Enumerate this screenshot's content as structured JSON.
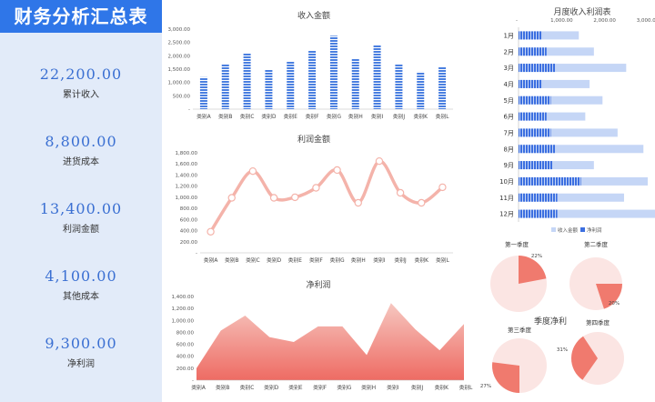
{
  "page_title": "财务分析汇总表",
  "kpis": [
    {
      "value": "22,200.00",
      "label": "累计收入"
    },
    {
      "value": "8,800.00",
      "label": "进货成本"
    },
    {
      "value": "13,400.00",
      "label": "利润金额"
    },
    {
      "value": "4,100.00",
      "label": "其他成本"
    },
    {
      "value": "9,300.00",
      "label": "净利润"
    }
  ],
  "colors": {
    "bar": "#4a7fe0",
    "line": "#f4b3aa",
    "area_top": "#f6c7c0",
    "area_bottom": "#ee6b63",
    "revenue_bar": "#c5d6f6",
    "profit_bar": "#3c6fe0",
    "pie_bg": "#fbe5e3",
    "pie_slice": "#f07a6e"
  },
  "chart_data": [
    {
      "type": "bar",
      "title": "收入金额",
      "categories": [
        "类别A",
        "类别B",
        "类别C",
        "类别D",
        "类别E",
        "类别F",
        "类别G",
        "类别H",
        "类别I",
        "类别J",
        "类别K",
        "类别L"
      ],
      "y_ticks": [
        "3,000.00",
        "2,500.00",
        "2,000.00",
        "1,500.00",
        "1,000.00",
        "500.00",
        "-"
      ],
      "ylim": [
        0,
        3000
      ],
      "values": [
        1200,
        1700,
        2100,
        1500,
        1800,
        2200,
        2750,
        1900,
        2400,
        1700,
        1400,
        1600
      ]
    },
    {
      "type": "line",
      "title": "利润金额",
      "categories": [
        "类别A",
        "类别B",
        "类别C",
        "类别D",
        "类别E",
        "类别F",
        "类别G",
        "类别H",
        "类别I",
        "类别J",
        "类别K",
        "类别L"
      ],
      "y_ticks": [
        "1,800.00",
        "1,600.00",
        "1,400.00",
        "1,200.00",
        "1,000.00",
        "800.00",
        "600.00",
        "400.00",
        "200.00",
        "-"
      ],
      "ylim": [
        0,
        1800
      ],
      "values": [
        380,
        990,
        1470,
        990,
        1000,
        1170,
        1490,
        900,
        1650,
        1080,
        900,
        1180
      ]
    },
    {
      "type": "area",
      "title": "净利润",
      "categories": [
        "类别A",
        "类别B",
        "类别C",
        "类别D",
        "类别E",
        "类别F",
        "类别G",
        "类别H",
        "类别I",
        "类别J",
        "类别K",
        "类别L"
      ],
      "y_ticks": [
        "1,400.00",
        "1,200.00",
        "1,000.00",
        "800.00",
        "600.00",
        "400.00",
        "200.00",
        "-"
      ],
      "ylim": [
        0,
        1400
      ],
      "values": [
        200,
        830,
        1080,
        720,
        640,
        900,
        900,
        420,
        1290,
        850,
        500,
        940
      ]
    },
    {
      "type": "bar",
      "orientation": "horizontal",
      "title": "月度收入利润表",
      "categories": [
        "1月",
        "2月",
        "3月",
        "4月",
        "5月",
        "6月",
        "7月",
        "8月",
        "9月",
        "10月",
        "11月",
        "12月"
      ],
      "x_ticks": [
        "-",
        "1,000.00",
        "2,000.00",
        "3,000.00"
      ],
      "xlim": [
        0,
        3000
      ],
      "legend": [
        "收入金额",
        "净利润"
      ],
      "legend_position": "bottom",
      "series": [
        {
          "name": "收入金额",
          "values": [
            1400,
            1750,
            2500,
            1650,
            1950,
            1550,
            2300,
            2900,
            1750,
            3000,
            2450,
            3200
          ]
        },
        {
          "name": "净利润",
          "values": [
            550,
            650,
            850,
            550,
            750,
            650,
            750,
            850,
            800,
            1450,
            900,
            900
          ]
        }
      ]
    },
    {
      "type": "pie",
      "title": "季度净利",
      "subcharts": [
        {
          "title": "第一季度",
          "value_label": "22%",
          "percent": 22
        },
        {
          "title": "第二季度",
          "value_label": "20%",
          "percent": 20
        },
        {
          "title": "第三季度",
          "value_label": "27%",
          "percent": 27
        },
        {
          "title": "第四季度",
          "value_label": "31%",
          "percent": 31
        }
      ]
    }
  ]
}
